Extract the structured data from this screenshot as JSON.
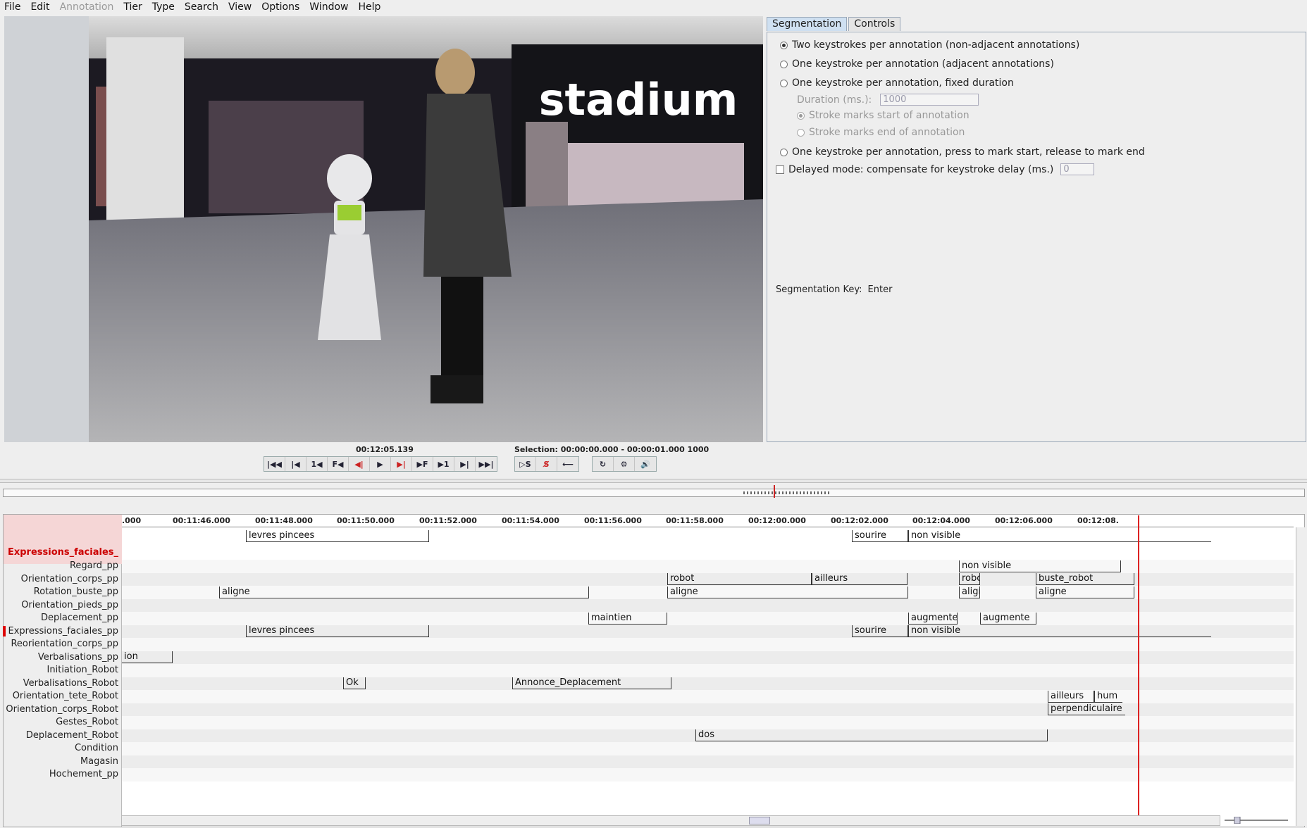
{
  "menubar": {
    "items": [
      {
        "label": "File",
        "enabled": true
      },
      {
        "label": "Edit",
        "enabled": true
      },
      {
        "label": "Annotation",
        "enabled": false
      },
      {
        "label": "Tier",
        "enabled": true
      },
      {
        "label": "Type",
        "enabled": true
      },
      {
        "label": "Search",
        "enabled": true
      },
      {
        "label": "View",
        "enabled": true
      },
      {
        "label": "Options",
        "enabled": true
      },
      {
        "label": "Window",
        "enabled": true
      },
      {
        "label": "Help",
        "enabled": true
      }
    ]
  },
  "panel": {
    "tabs": [
      {
        "label": "Segmentation",
        "active": true
      },
      {
        "label": "Controls",
        "active": false
      }
    ],
    "segmentation": {
      "opt1": "Two keystrokes per annotation (non-adjacent annotations)",
      "opt2": "One keystroke per annotation (adjacent annotations)",
      "opt3": "One keystroke per annotation, fixed duration",
      "duration_label": "Duration (ms.):",
      "duration_value": "1000",
      "stroke_start": "Stroke marks start of annotation",
      "stroke_end": "Stroke marks end of annotation",
      "opt4": "One keystroke per annotation, press to mark start, release to mark end",
      "delayed_label": "Delayed mode: compensate for keystroke delay (ms.)",
      "delayed_value": "0",
      "seg_key_label": "Segmentation Key:",
      "seg_key_value": "Enter"
    }
  },
  "controls": {
    "timecode": "00:12:05.139",
    "selection": "Selection: 00:00:00.000 - 00:00:01.000  1000"
  },
  "video": {
    "store_sign": "stadium"
  },
  "timeline": {
    "active_tier": "Expressions_faciales_",
    "ruler_ticks": [
      ".000",
      "00:11:46.000",
      "00:11:48.000",
      "00:11:50.000",
      "00:11:52.000",
      "00:11:54.000",
      "00:11:56.000",
      "00:11:58.000",
      "00:12:00.000",
      "00:12:02.000",
      "00:12:04.000",
      "00:12:06.000",
      "00:12:08."
    ],
    "tiers": [
      "Regard_pp",
      "Orientation_corps_pp",
      "Rotation_buste_pp",
      "Orientation_pieds_pp",
      "Deplacement_pp",
      "Expressions_faciales_pp",
      "Reorientation_corps_pp",
      "Verbalisations_pp",
      "Initiation_Robot",
      "Verbalisations_Robot",
      "Orientation_tete_Robot",
      "Orientation_corps_Robot",
      "Gestes_Robot",
      "Deplacement_Robot",
      "Condition",
      "Magasin",
      "Hochement_pp"
    ],
    "active_annotations": [
      "levres pincees",
      "sourire",
      "non visible"
    ],
    "annotations": [
      [
        "non visible"
      ],
      [
        "robot",
        "ailleurs",
        "robot",
        "buste_robot"
      ],
      [
        "aligne",
        "aligne",
        "align",
        "aligne"
      ],
      [],
      [
        "maintien",
        "augmente",
        "augmente"
      ],
      [
        "levres pincees",
        "sourire",
        "non visible"
      ],
      [],
      [
        "ion"
      ],
      [],
      [
        "Ok",
        "Annonce_Deplacement"
      ],
      [
        "ailleurs",
        "hum"
      ],
      [
        "perpendiculaire"
      ],
      [],
      [
        "dos"
      ],
      [],
      [],
      []
    ]
  }
}
